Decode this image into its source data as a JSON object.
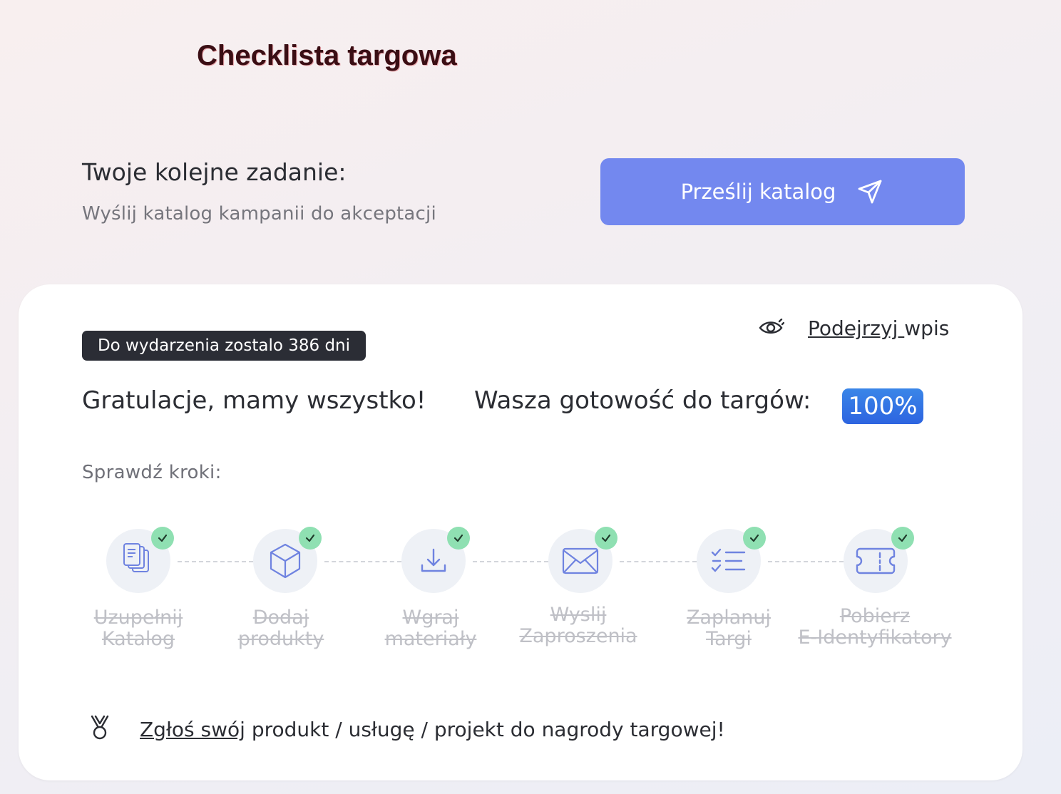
{
  "page": {
    "title": "Checklista targowa"
  },
  "task": {
    "heading": "Twoje kolejne zadanie:",
    "description": "Wyślij katalog kampanii do akceptacji",
    "button_label": "Prześlij katalog",
    "button_icon": "send-icon",
    "button_color": "#7388ef"
  },
  "card": {
    "preview": {
      "icon": "eye-icon",
      "label_underlined": "Podejrzyj ",
      "label_rest": "wpis"
    },
    "countdown": "Do wydarzenia zostalo 386 dni",
    "congrats": "Gratulacje, mamy wszystko!",
    "readiness_label": "Wasza gotowość do targów:",
    "readiness_value": "100%",
    "readiness_fraction": 1.0,
    "steps_heading": "Sprawdź kroki:",
    "steps": [
      {
        "line1": "Uzupełnij",
        "line2": "Katalog",
        "icon": "documents-icon",
        "done": true
      },
      {
        "line1": "Dodaj",
        "line2": "produkty",
        "icon": "box-icon",
        "done": true
      },
      {
        "line1": "Wgraj",
        "line2": "materiały",
        "icon": "download-icon",
        "done": true
      },
      {
        "line1": "Wyslij",
        "line2": "Zaproszenia",
        "icon": "envelope-icon",
        "done": true
      },
      {
        "line1": "Zaplanuj",
        "line2": "Targi",
        "icon": "checklist-icon",
        "done": true
      },
      {
        "line1": "Pobierz",
        "line2": "E-Identyfikatory",
        "icon": "ticket-icon",
        "done": true
      }
    ],
    "award": {
      "icon": "medal-icon",
      "link_text": "Zgłoś swój",
      "rest_text": " produkt / usługę / projekt do nagrody targowej!"
    }
  },
  "colors": {
    "accent": "#7388ef",
    "badge_blue": "#2d64e0",
    "check_green": "#8fe0b2",
    "countdown_bg": "#2b2d35"
  }
}
